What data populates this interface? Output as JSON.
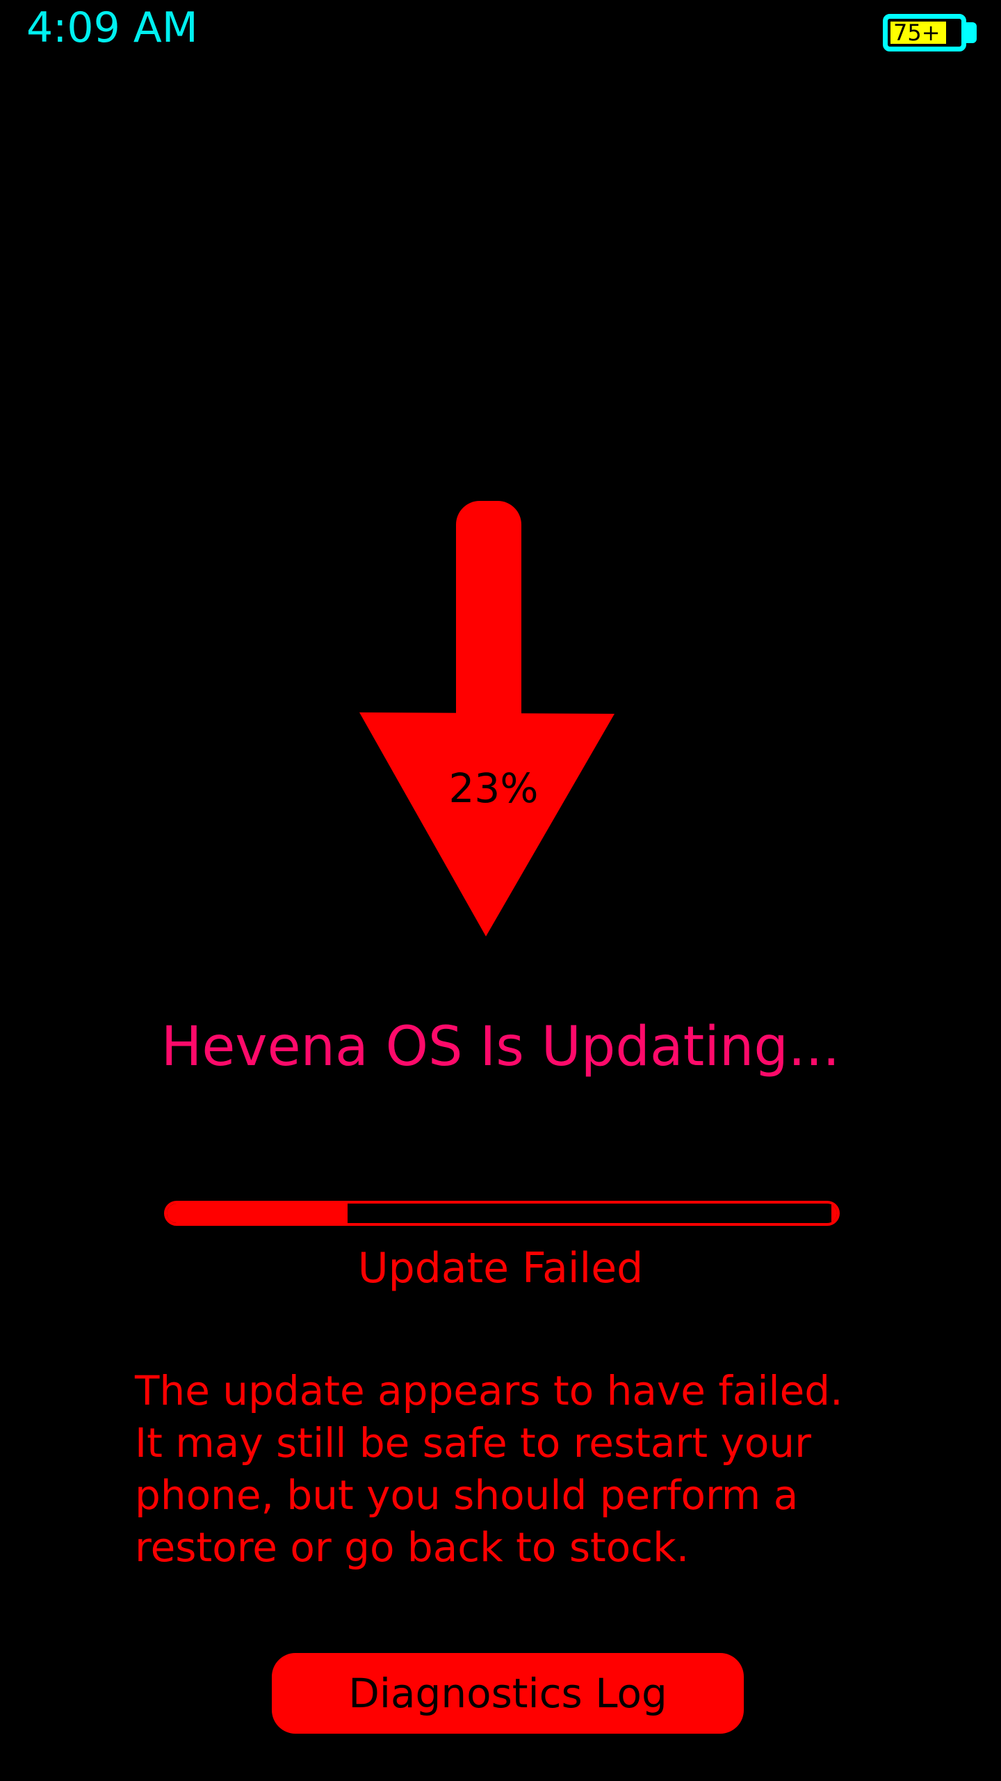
{
  "status_bar": {
    "time": "4:09 AM",
    "battery_label": "75+",
    "battery_icon": "battery-icon",
    "colors": {
      "time": "#00f0f0",
      "battery_outline": "#00ffff",
      "battery_fill": "#ffff00"
    }
  },
  "update": {
    "arrow_icon": "download-arrow-icon",
    "percent_text": "23%",
    "title": "Hevena OS Is Updating...",
    "progress": 0.27,
    "status": "Update Failed",
    "message_lines": [
      "The update appears to have failed.",
      "It may still be safe to restart your",
      "phone, but you should perform a",
      "restore or go back to stock."
    ],
    "button_label": "Diagnostics Log",
    "colors": {
      "accent": "#ff0000",
      "title": "#ff0a6a",
      "background": "#000000"
    }
  }
}
